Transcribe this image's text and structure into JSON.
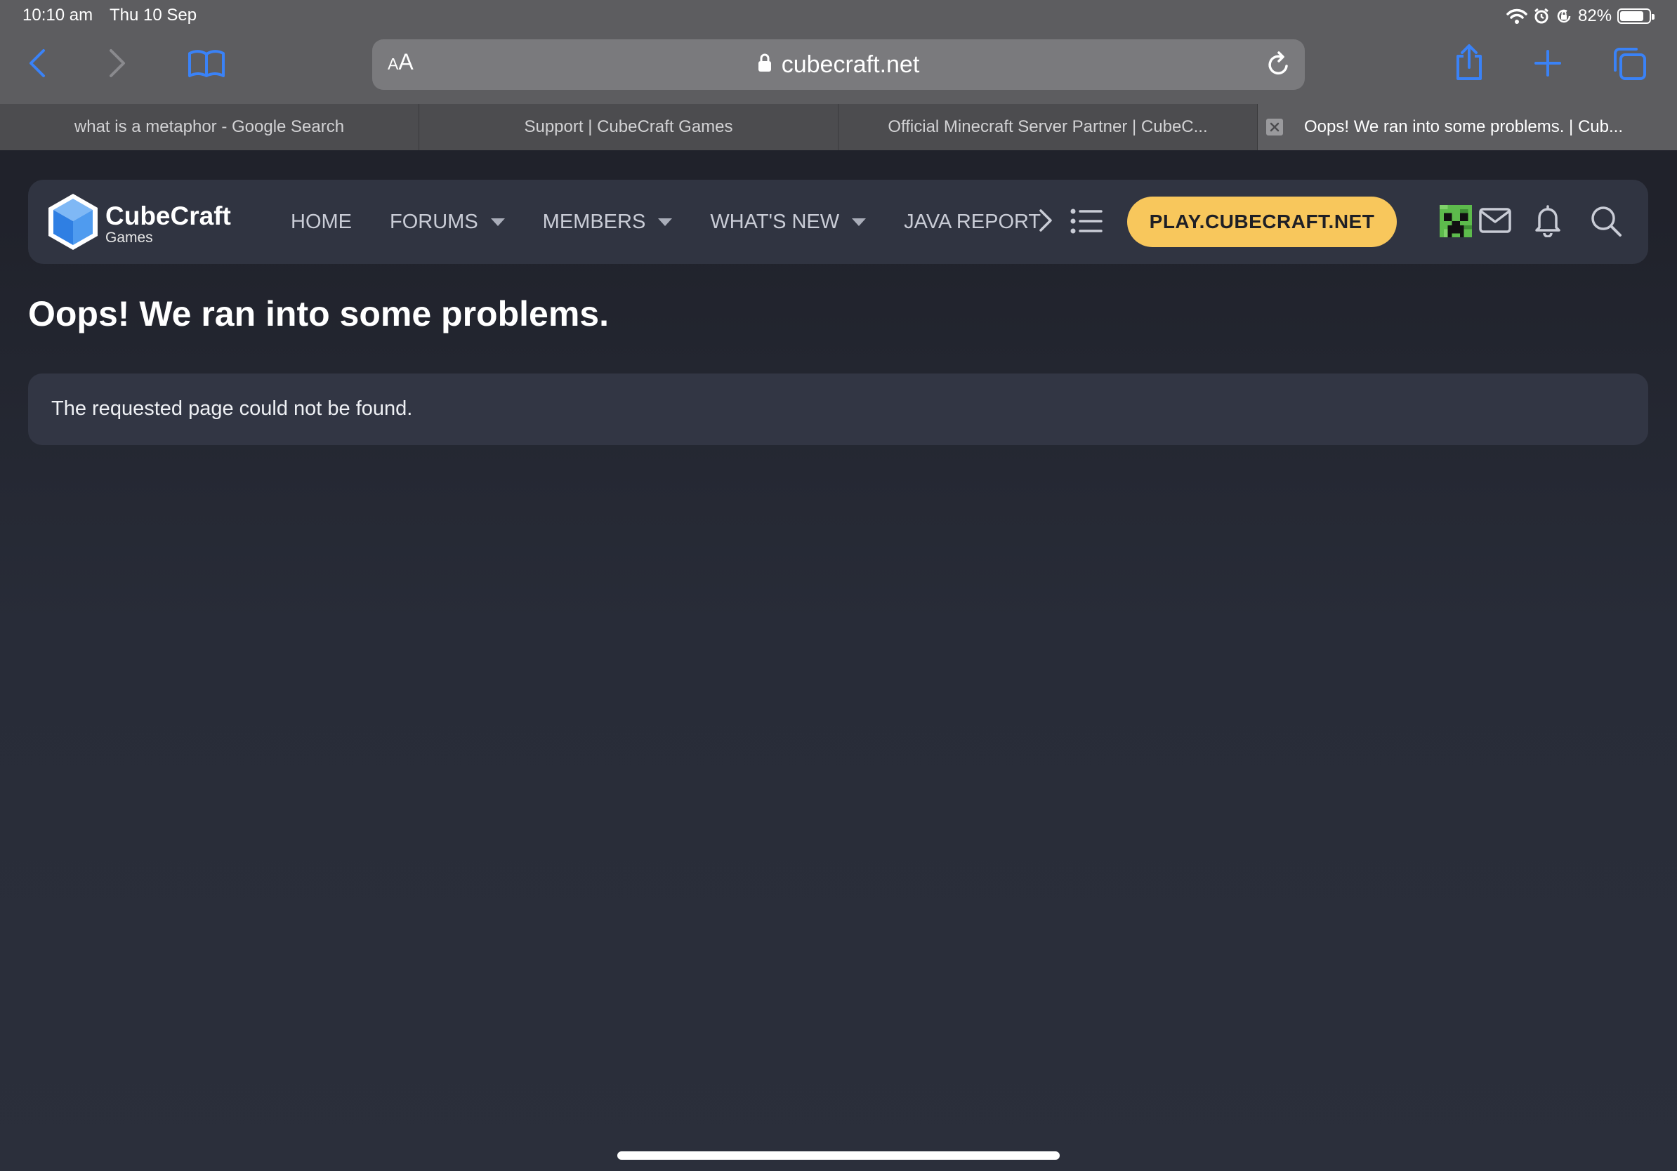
{
  "status_bar": {
    "time": "10:10 am",
    "date": "Thu 10 Sep",
    "battery_percent": "82%",
    "battery_level": 0.82,
    "icons": [
      "wifi-icon",
      "alarm-icon",
      "orientation-lock-icon",
      "battery-icon"
    ]
  },
  "browser": {
    "aa_small": "A",
    "aa_large": "A",
    "url": "cubecraft.net",
    "toolbar_icons": [
      "back-icon",
      "forward-icon",
      "bookmarks-icon",
      "share-icon",
      "new-tab-icon",
      "tabs-overview-icon"
    ],
    "accent_color": "#3a82f7",
    "tabs": [
      {
        "title": "what is a metaphor - Google Search",
        "active": false
      },
      {
        "title": "Support | CubeCraft Games",
        "active": false
      },
      {
        "title": "Official Minecraft Server Partner | CubeC...",
        "active": false
      },
      {
        "title": "Oops! We ran into some problems. | Cub...",
        "active": true
      }
    ]
  },
  "site_nav": {
    "logo_name": "CubeCraft",
    "logo_sub": "Games",
    "items": [
      {
        "label": "HOME",
        "dropdown": false
      },
      {
        "label": "FORUMS",
        "dropdown": true
      },
      {
        "label": "MEMBERS",
        "dropdown": true
      },
      {
        "label": "WHAT'S NEW",
        "dropdown": true
      },
      {
        "label": "JAVA REPORT",
        "dropdown": false
      }
    ],
    "play_button": "PLAY.CUBECRAFT.NET",
    "play_color": "#f8c75c",
    "icons": [
      "chevron-right-icon",
      "list-icon",
      "avatar",
      "mail-icon",
      "bell-icon",
      "search-icon"
    ]
  },
  "main": {
    "title": "Oops! We ran into some problems.",
    "message": "The requested page could not be found."
  }
}
